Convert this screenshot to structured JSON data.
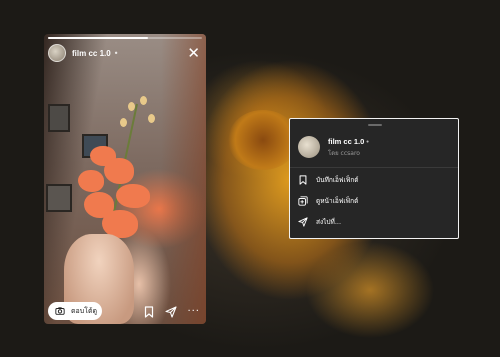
{
  "story": {
    "username": "film cc 1.0",
    "separator": "•",
    "progress": 0.65,
    "reply_label": "ตอบโต้ดู",
    "icons": {
      "close": "close-icon",
      "camera": "camera-icon",
      "bookmark": "bookmark-icon",
      "send": "send-icon",
      "more": "more-icon"
    },
    "more_glyph": "···",
    "close_glyph": "✕"
  },
  "popup": {
    "title": "film cc 1.0",
    "title_separator": "•",
    "subtitle": "โดย ccsaro",
    "menu": [
      {
        "label": "บันทึกเอ็ฟเฟ็กต์",
        "icon": "bookmark-icon"
      },
      {
        "label": "ดูหน้าเอ็ฟเฟ็กต์",
        "icon": "effect-page-icon"
      },
      {
        "label": "ส่งไปที่...",
        "icon": "send-icon"
      }
    ]
  },
  "colors": {
    "popup_bg": "#262626",
    "popup_border": "#f2f2f2",
    "accent_flower": "#e0a020"
  }
}
